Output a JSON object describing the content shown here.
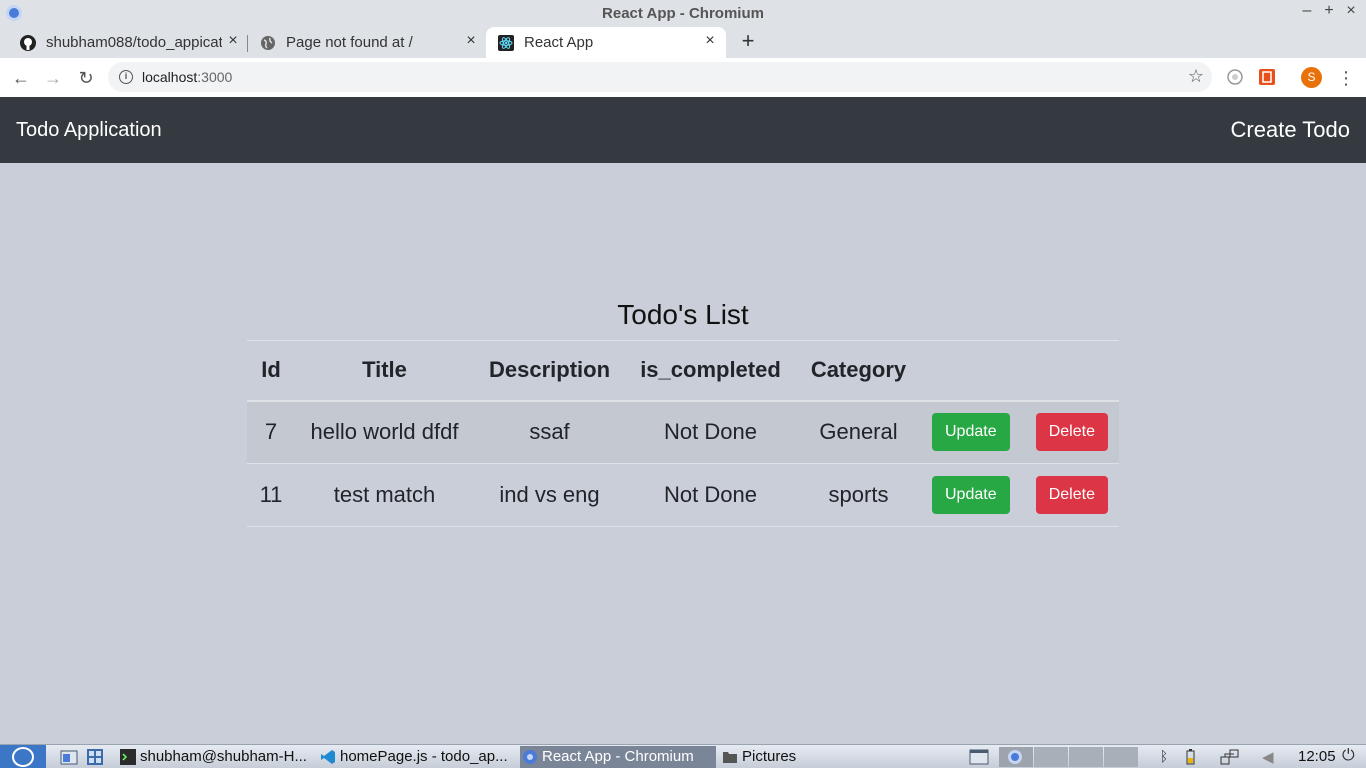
{
  "window": {
    "title": "React App - Chromium"
  },
  "tabs": [
    {
      "title": "shubham088/todo_appicat",
      "icon": "github-icon"
    },
    {
      "title": "Page not found at /",
      "icon": "globe-icon"
    },
    {
      "title": "React App",
      "icon": "react-icon"
    }
  ],
  "toolbar": {
    "url_host": "localhost",
    "url_port": ":3000",
    "avatar_letter": "S"
  },
  "app": {
    "brand": "Todo Application",
    "create_link": "Create Todo",
    "list_title": "Todo's List",
    "columns": [
      "Id",
      "Title",
      "Description",
      "is_completed",
      "Category",
      ""
    ],
    "rows": [
      {
        "id": "7",
        "title": "hello world dfdf",
        "description": "ssaf",
        "is_completed": "Not Done",
        "category": "General",
        "update_label": "Update",
        "delete_label": "Delete"
      },
      {
        "id": "11",
        "title": "test match",
        "description": "ind vs eng",
        "is_completed": "Not Done",
        "category": "sports",
        "update_label": "Update",
        "delete_label": "Delete"
      }
    ]
  },
  "taskbar": {
    "tasks": [
      {
        "label": "shubham@shubham-H...",
        "icon": "terminal-icon"
      },
      {
        "label": "homePage.js - todo_ap...",
        "icon": "vscode-icon"
      },
      {
        "label": "React App - Chromium",
        "icon": "chromium-icon"
      },
      {
        "label": "Pictures",
        "icon": "folder-icon"
      }
    ],
    "clock": "12:05"
  },
  "colors": {
    "navbar": "#343a40",
    "page_bg": "#c9ced9",
    "success": "#28a745",
    "danger": "#dc3545"
  }
}
